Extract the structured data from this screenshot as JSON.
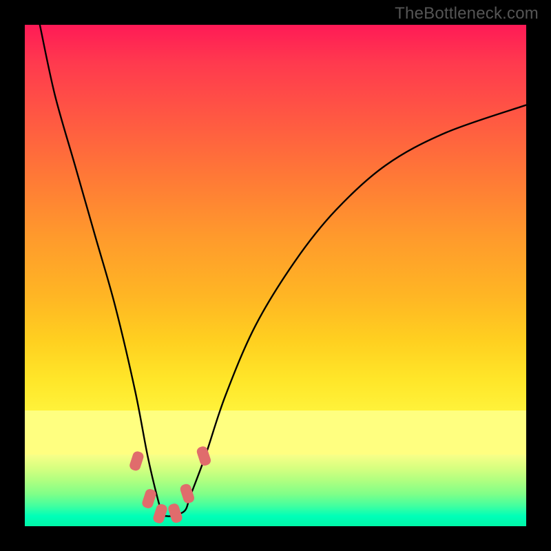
{
  "watermark": "TheBottleneck.com",
  "chart_data": {
    "type": "line",
    "title": "",
    "xlabel": "",
    "ylabel": "",
    "xlim": [
      0,
      100
    ],
    "ylim": [
      0,
      100
    ],
    "series": [
      {
        "name": "curve",
        "x": [
          3,
          6,
          10,
          14,
          18,
          22,
          24.5,
          26.5,
          27.5,
          28.5,
          30,
          32,
          33,
          36,
          40,
          46,
          54,
          62,
          72,
          84,
          100
        ],
        "y": [
          100,
          86,
          72,
          58,
          44,
          27,
          14,
          5.5,
          2.5,
          2,
          2.2,
          3.2,
          6,
          14,
          26,
          40,
          53,
          63,
          72,
          78.5,
          84
        ]
      }
    ],
    "markers": {
      "shape": "rounded-rect",
      "color": "#e06c6c",
      "points_xy": [
        [
          22.3,
          13.0
        ],
        [
          24.8,
          5.5
        ],
        [
          27.0,
          2.5
        ],
        [
          30.0,
          2.6
        ],
        [
          32.4,
          6.5
        ],
        [
          35.7,
          14.0
        ]
      ]
    },
    "background": {
      "type": "vertical-gradient",
      "stops": [
        {
          "pos": 0.0,
          "color": "#ff1a56"
        },
        {
          "pos": 0.45,
          "color": "#ff9a2c"
        },
        {
          "pos": 0.76,
          "color": "#ffea30"
        },
        {
          "pos": 0.78,
          "color": "#ffff80"
        },
        {
          "pos": 0.86,
          "color": "#ffff80"
        },
        {
          "pos": 1.0,
          "color": "#00f7a8"
        }
      ]
    }
  }
}
